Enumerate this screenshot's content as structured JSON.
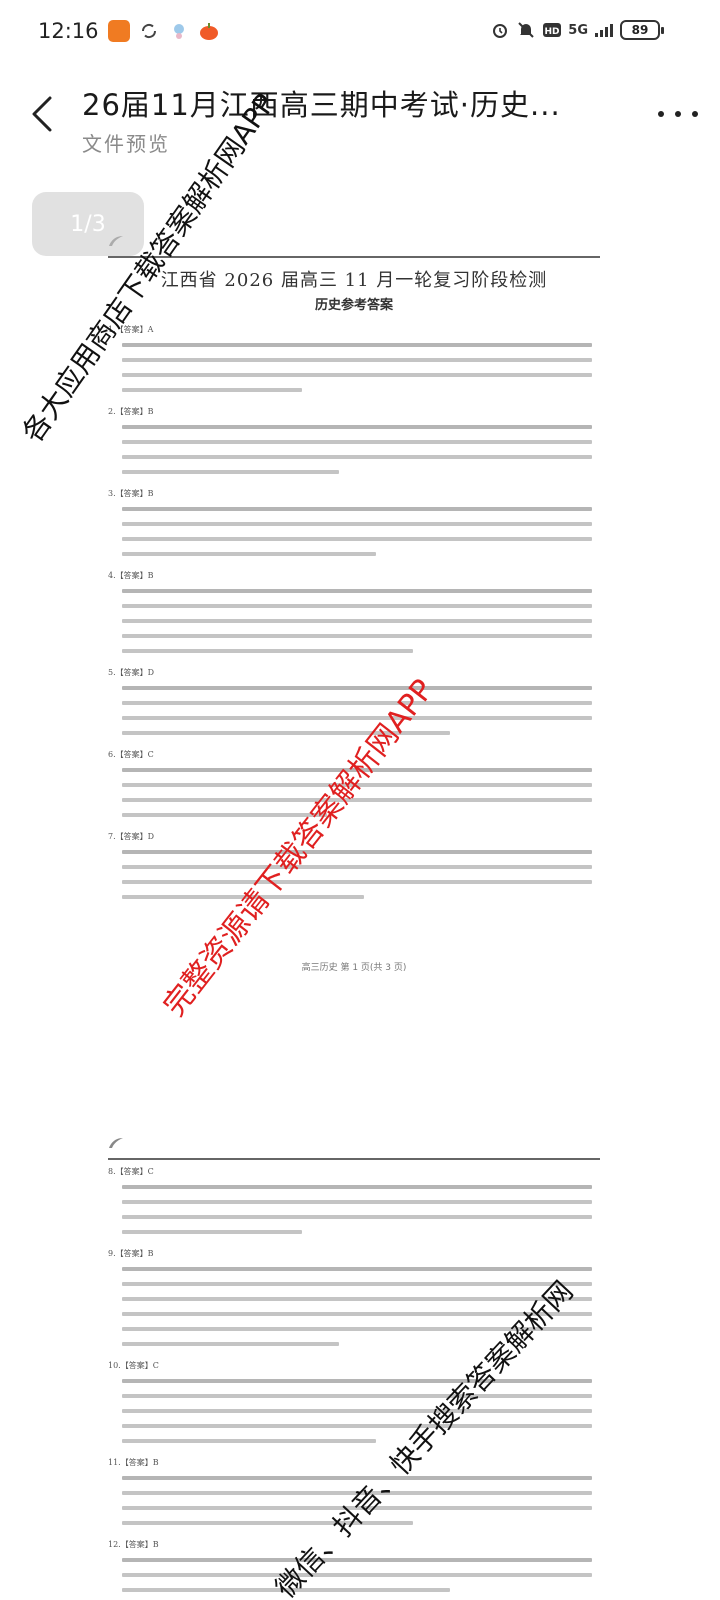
{
  "status_bar": {
    "time": "12:16",
    "network": "5G",
    "battery": "89"
  },
  "header": {
    "title": "26届11月江西高三期中考试·历史...",
    "subtitle": "文件预览"
  },
  "viewer": {
    "page_indicator": "1/3"
  },
  "document": {
    "page1": {
      "heading": "江西省 2026 届高三 11 月一轮复习阶段检测",
      "subheading": "历史参考答案",
      "questions": [
        "1.【答案】A",
        "2.【答案】B",
        "3.【答案】B",
        "4.【答案】B",
        "5.【答案】D",
        "6.【答案】C",
        "7.【答案】D"
      ],
      "footer": "高三历史 第 1 页(共 3 页)"
    },
    "page2": {
      "questions": [
        "8.【答案】C",
        "9.【答案】B",
        "10.【答案】C",
        "11.【答案】B",
        "12.【答案】B"
      ]
    }
  },
  "watermarks": {
    "top": "各大应用商店下载答案解析网APP",
    "middle": "完整资源请下载答案解析网APP",
    "bottom": "微信、抖音、快手搜索答案解析网"
  },
  "colors": {
    "watermark_red": "#e02020",
    "watermark_black": "#111111",
    "page_indicator_bg": "#c8c8c8"
  }
}
